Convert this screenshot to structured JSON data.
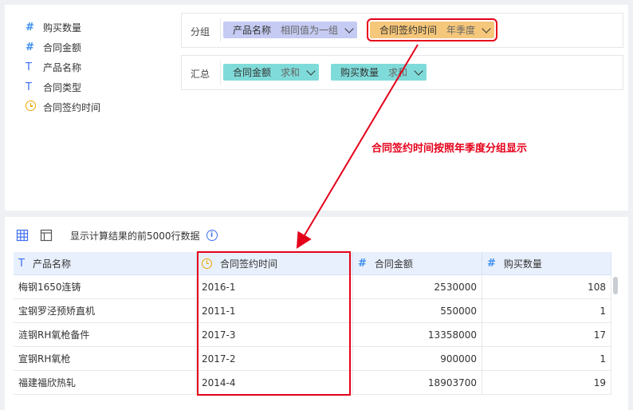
{
  "fields": [
    {
      "icon": "#",
      "type": "number",
      "label": "购买数量"
    },
    {
      "icon": "#",
      "type": "number",
      "label": "合同金额"
    },
    {
      "icon": "T",
      "type": "text",
      "label": "产品名称"
    },
    {
      "icon": "T",
      "type": "text",
      "label": "合同类型"
    },
    {
      "icon": "clock",
      "type": "date",
      "label": "合同签约时间"
    }
  ],
  "group_zone": {
    "label": "分组",
    "pills": [
      {
        "name": "产品名称",
        "mode": "相同值为一组",
        "color": "#c5cbf2"
      },
      {
        "name": "合同签约时间",
        "mode": "年季度",
        "color": "#f5c77a"
      }
    ]
  },
  "summary_zone": {
    "label": "汇总",
    "pills": [
      {
        "name": "合同金额",
        "mode": "求和",
        "color": "#7fdbd9"
      },
      {
        "name": "购买数量",
        "mode": "求和",
        "color": "#7fdbd9"
      }
    ]
  },
  "annotation": "合同签约时间按照年季度分组显示",
  "toolbar": {
    "info_text": "显示计算结果的前5000行数据"
  },
  "table": {
    "headers": [
      "产品名称",
      "合同签约时间",
      "合同金额",
      "购买数量"
    ],
    "rows": [
      [
        "梅钢1650连铸",
        "2016-1",
        "2530000",
        "108"
      ],
      [
        "宝钢罗泾预矫直机",
        "2011-1",
        "550000",
        "1"
      ],
      [
        "涟钢RH氧枪备件",
        "2017-3",
        "13358000",
        "17"
      ],
      [
        "宣钢RH氧枪",
        "2017-2",
        "900000",
        "1"
      ],
      [
        "福建福欣热轧",
        "2014-4",
        "18903700",
        "19"
      ]
    ]
  },
  "colors": {
    "accent": "#3d6ef0",
    "highlight": "#e5001a",
    "date_icon": "#f0a500"
  }
}
